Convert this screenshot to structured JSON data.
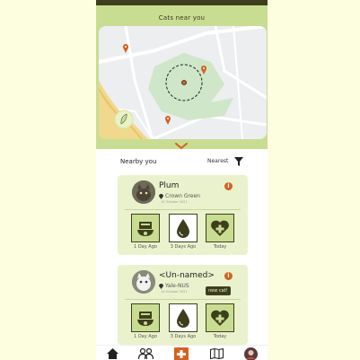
{
  "header": {
    "title": "Cats near you"
  },
  "section": {
    "title": "Nearby you",
    "sort_label": "Nearest"
  },
  "cards": [
    {
      "name": "Plum",
      "location": "Crown Green",
      "time": "19 October 2021",
      "badge": "",
      "stats": [
        {
          "icon": "food-bowl-icon",
          "label": "1 Day Ago"
        },
        {
          "icon": "water-drop-icon",
          "label": "3 Days Ago"
        },
        {
          "icon": "health-heart-icon",
          "label": "Today"
        }
      ]
    },
    {
      "name": "<Un-named>",
      "location": "Yale-NUS",
      "time": "19 October 2021",
      "badge": "new cat!",
      "stats": [
        {
          "icon": "food-bowl-icon",
          "label": "1 Day Ago"
        },
        {
          "icon": "water-drop-icon",
          "label": "3 Days Ago"
        },
        {
          "icon": "health-heart-icon",
          "label": "Today"
        }
      ]
    }
  ],
  "nav": [
    "home-icon",
    "community-icon",
    "add-icon",
    "map-icon",
    "profile-icon"
  ],
  "colors": {
    "accent": "#d4621f",
    "dark": "#3d3f1c",
    "light_green": "#c9dd92",
    "card_bg": "#eaf2cd",
    "page_bg": "#fdfee0"
  }
}
